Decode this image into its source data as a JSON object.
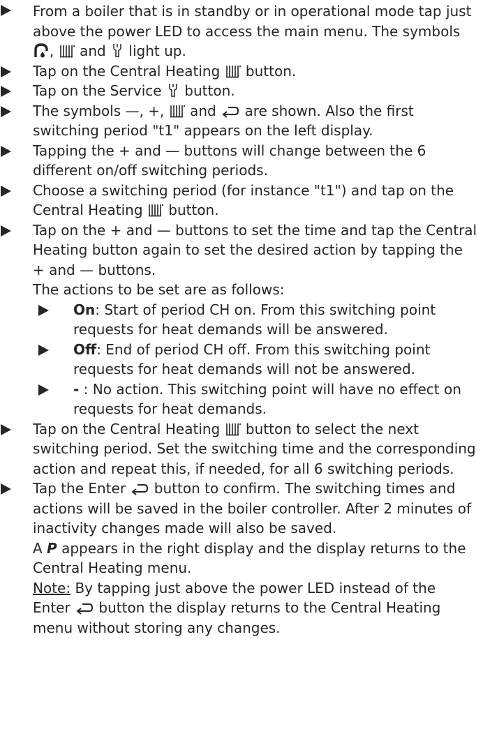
{
  "steps": [
    {
      "t1": "From a boiler that is in standby or in operational mode tap just above the power LED to access the main menu. The symbols ",
      "t2": ", ",
      "t3": " and ",
      "t4": " light up."
    },
    {
      "t1": "Tap on the Central Heating ",
      "t2": " button."
    },
    {
      "t1": "Tap on the Service ",
      "t2": " button."
    },
    {
      "t1": "The symbols ",
      "minus": "—",
      "t2": ", ",
      "plus": "+",
      "t3": ", ",
      "t4": " and ",
      "t5": " are shown. Also the first switching period \"t1\" appears on the left display."
    },
    {
      "t1": "Tapping the ",
      "plus": "+",
      "t2": " and ",
      "minus": "—",
      "t3": " buttons will change between the 6 different on/off switching periods."
    },
    {
      "t1": " Choose a switching period (for instance \"t1\") and tap on the Central Heating ",
      "t2": " button."
    },
    {
      "t1": "Tap on the ",
      "plus": "+",
      "t2": " and ",
      "minus": "—",
      "t3": " buttons to set the time and tap the Central Heating button again to set the desired action by tapping the ",
      "plus2": "+",
      "t4": " and ",
      "minus2": "—",
      "t5": " buttons.",
      "t6": "The actions to be set are as follows:"
    },
    {
      "t1": "Tap on the Central Heating ",
      "t2": " button to select the next switching period. Set the switching time and the corresponding action and repeat this, if needed, for all 6 switching periods."
    },
    {
      "t1": "Tap the Enter ",
      "t2": " button to confirm. The switching times and actions will be saved in the boiler controller. After 2 minutes of inactivity changes made will also be saved.",
      "t3": "A ",
      "p": "P",
      "t4": " appears in the right display and the display returns to the Central Heating menu.",
      "note_label": "Note:",
      "t5": " By tapping just above the power LED instead of the Enter ",
      "t6": " button the display returns to the Central Heating menu without storing any changes."
    }
  ],
  "actions": [
    {
      "label": "On",
      "text": ": Start of period CH on. From this switching point requests for heat demands will be answered."
    },
    {
      "label": "Off",
      "text": ": End of period CH off. From this switching point requests for heat demands will not be answered."
    },
    {
      "label": "-",
      "text": " : No action. This switching point will have no effect on requests for heat demands."
    }
  ],
  "icons": {
    "tap": "tap-water-icon",
    "ch": "central-heating-icon",
    "service": "service-wrench-icon",
    "enter": "enter-return-icon"
  }
}
